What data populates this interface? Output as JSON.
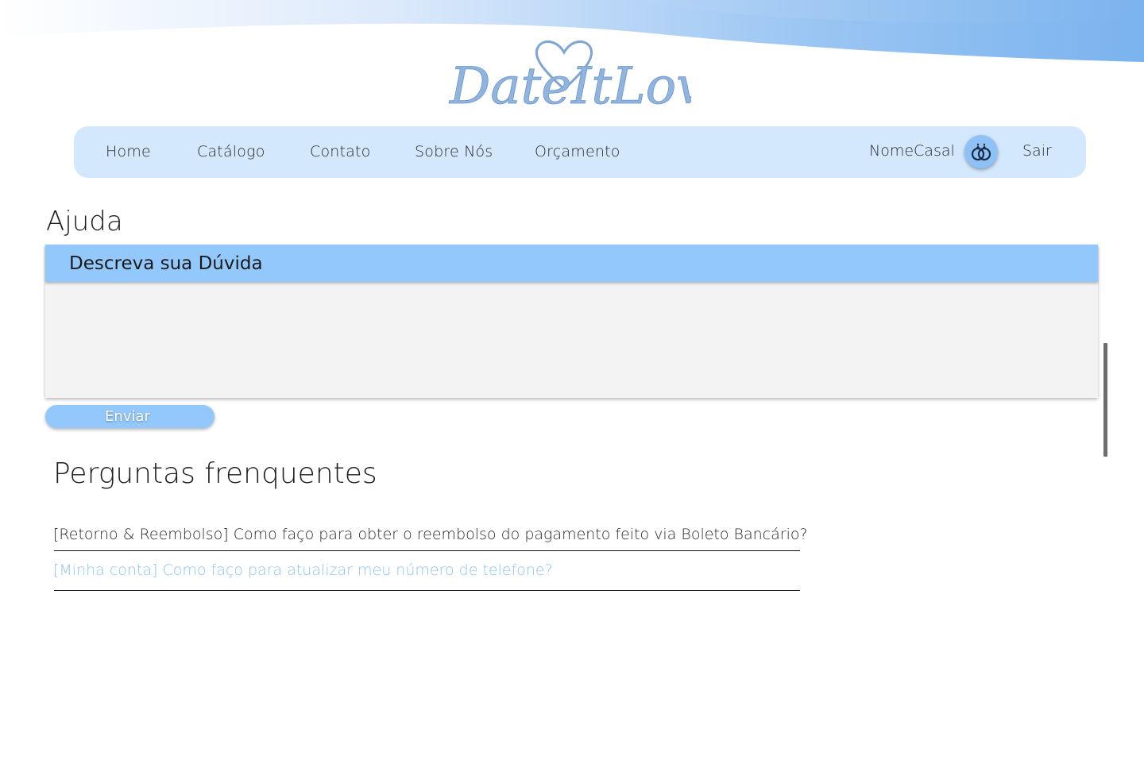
{
  "brand": {
    "logo_text": "DateItLove",
    "colors": {
      "primary": "#92c8fb",
      "nav_background": "#d4e8fd",
      "wave": "#7fb6ef",
      "link_light": "#8ec4f2"
    }
  },
  "nav": {
    "items": [
      {
        "label": "Home"
      },
      {
        "label": "Catálogo"
      },
      {
        "label": "Contato"
      },
      {
        "label": "Sobre Nós"
      },
      {
        "label": "Orçamento"
      }
    ],
    "couple_name": "NomeCasal",
    "avatar_icon": "rings-icon",
    "logout_label": "Sair"
  },
  "help": {
    "title": "Ajuda",
    "question_header": "Descreva sua Dúvida",
    "question_value": "",
    "send_label": "Enviar"
  },
  "faq": {
    "title": "Perguntas frenquentes",
    "items": [
      {
        "text": "[Retorno & Reembolso] Como faço para obter o reembolso do pagamento feito via Boleto Bancário?"
      },
      {
        "text": "[Minha conta] Como faço para atualizar meu número de telefone?"
      }
    ]
  }
}
